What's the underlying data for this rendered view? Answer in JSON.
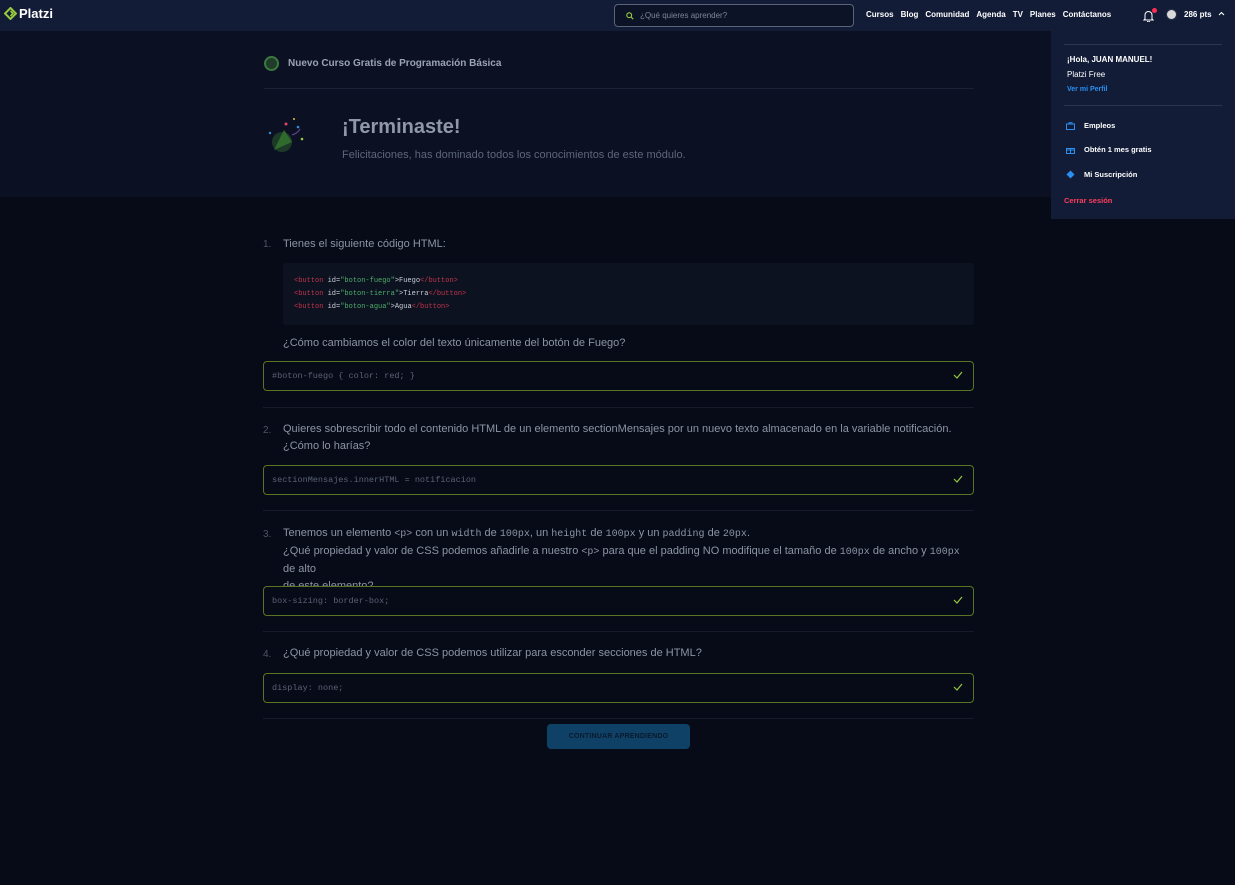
{
  "nav": {
    "logo_text": "Platzi",
    "search_placeholder": "¿Qué quieres aprender?",
    "links": [
      "Cursos",
      "Blog",
      "Comunidad",
      "Agenda",
      "TV",
      "Planes",
      "Contáctanos"
    ],
    "points": "286 pts"
  },
  "hero": {
    "course_title": "Nuevo Curso Gratis de Programación Básica",
    "title": "¡Terminaste!",
    "subtitle": "Felicitaciones, has dominado todos los conocimientos de este módulo."
  },
  "questions": [
    {
      "number": "1.",
      "intro": "Tienes el siguiente código HTML:",
      "code_lines": [
        {
          "tag_open": "<button",
          "attr": " id=",
          "value": "\"boton-fuego\"",
          "close": ">",
          "text": "Fuego",
          "tag_end": "</button>"
        },
        {
          "tag_open": "<button",
          "attr": " id=",
          "value": "\"boton-tierra\"",
          "close": ">",
          "text": "Tierra",
          "tag_end": "</button>"
        },
        {
          "tag_open": "<button",
          "attr": " id=",
          "value": "\"boton-agua\"",
          "close": ">",
          "text": "Agua",
          "tag_end": "</button>"
        }
      ],
      "question": "¿Cómo cambiamos el color del texto únicamente del botón de Fuego?",
      "answer": "#boton-fuego { color: red; }"
    },
    {
      "number": "2.",
      "text_line1": "Quieres sobrescribir todo el contenido HTML de un elemento sectionMensajes por un nuevo texto almacenado en la variable notificación.",
      "text_line2": "¿Cómo lo harías?",
      "answer": "sectionMensajes.innerHTML = notificacion"
    },
    {
      "number": "3.",
      "l1_a": "Tenemos un elemento ",
      "l1_p": "<p>",
      "l1_b": " con un ",
      "l1_width": "width",
      "l1_c": " de ",
      "l1_100a": "100px",
      "l1_d": ", un ",
      "l1_height": "height",
      "l1_e": " de ",
      "l1_100b": "100px",
      "l1_f": " y un ",
      "l1_padding": "padding",
      "l1_g": " de ",
      "l1_20": "20px",
      "l1_h": ".",
      "l2_a": "¿Qué propiedad y valor de CSS podemos añadirle a nuestro ",
      "l2_p": "<p>",
      "l2_b": " para que el padding NO modifique el tamaño de ",
      "l2_100a": "100px",
      "l2_c": " de ancho y ",
      "l2_100b": "100px",
      "l2_d": " de alto",
      "l3": "de este elemento?",
      "answer": "box-sizing: border-box;"
    },
    {
      "number": "4.",
      "text": "¿Qué propiedad y valor de CSS podemos utilizar para esconder secciones de HTML?",
      "answer": "display: none;"
    }
  ],
  "cta_label": "CONTINUAR APRENDIENDO",
  "menu": {
    "greeting": "¡Hola, JUAN MANUEL!",
    "plan": "Platzi Free",
    "profile_link": "Ver mi Perfil",
    "items": [
      "Empleos",
      "Obtén 1 mes gratis",
      "Mi Suscripción"
    ],
    "logout": "Cerrar sesión"
  },
  "colors": {
    "accent_green": "#98ca3f",
    "link_blue": "#2a8ff0",
    "logout_red": "#ff3d5a",
    "notification_red": "#ff2d55"
  }
}
